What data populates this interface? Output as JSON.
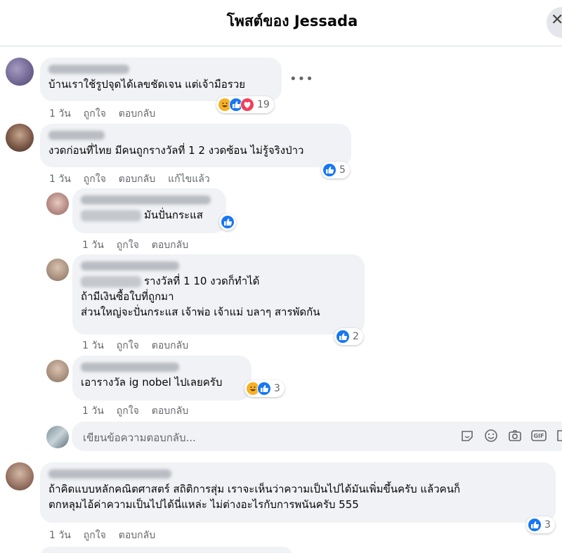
{
  "header": {
    "title": "โพสต์ของ Jessada"
  },
  "comments": [
    {
      "text": "บ้านเราใช้รูปจุดได้เลขชัดเจน แต่เจ้ามือรวย",
      "time": "1 วัน",
      "like": "ถูกใจ",
      "reply": "ตอบกลับ",
      "reactions": "19"
    },
    {
      "text": "งวดก่อนที่ไทย มีคนถูกรางวัลที่ 1 2 งวดซ้อน ไม่รู้จริงป่าว",
      "time": "1 วัน",
      "like": "ถูกใจ",
      "reply": "ตอบกลับ",
      "edited": "แก้ไขแล้ว",
      "reactions": "5"
    },
    {
      "text": "มันปั่นกระแส",
      "time": "1 วัน",
      "like": "ถูกใจ",
      "reply": "ตอบกลับ"
    },
    {
      "line1": "รางวัลที่ 1 10 งวดก็ทำได้",
      "line2": "ถ้ามีเงินซื้อใบที่ถูกมา",
      "line3": "ส่วนใหญ่จะปั่นกระแส เจ้าพ่อ เจ้าแม่ บลาๆ สารพัดกัน",
      "time": "1 วัน",
      "like": "ถูกใจ",
      "reply": "ตอบกลับ",
      "reactions": "2"
    },
    {
      "text": "เอารางวัล ig nobel ไปเลยครับ",
      "time": "1 วัน",
      "like": "ถูกใจ",
      "reply": "ตอบกลับ",
      "reactions": "3"
    },
    {
      "line1": "ถ้าคิดแบบหลักคณิตศาสตร์ สถิติการสุ่ม เราจะเห็นว่าความเป็นไปได้มันเพิ่มขึ้นครับ แล้วคนก็",
      "line2": "ตกหลุมไอ้ค่าความเป็นไปได้นี่แหล่ะ ไม่ต่างอะไรกับการพนันครับ 555",
      "time": "1 วัน",
      "like": "ถูกใจ",
      "reply": "ตอบกลับ",
      "reactions": "3"
    }
  ],
  "reply_box": {
    "placeholder": "เขียนข้อความตอบกลับ...",
    "gif": "GIF"
  },
  "colors": {
    "like": "#1877f2",
    "bubble": "#f0f2f5",
    "meta": "#65676b"
  },
  "icons": [
    "close-icon",
    "more-icon",
    "like-icon",
    "haha-icon",
    "love-icon",
    "sticker-icon",
    "emoji-icon",
    "camera-icon",
    "gif-icon"
  ]
}
